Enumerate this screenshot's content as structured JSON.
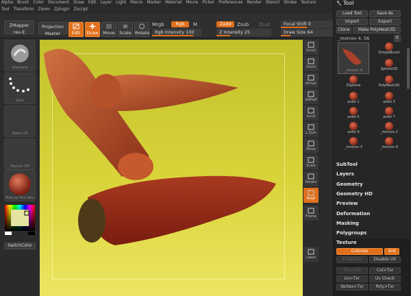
{
  "menu": {
    "row1": [
      "Alpha",
      "Brush",
      "Color",
      "Document",
      "Draw",
      "Edit",
      "Layer",
      "Light",
      "Macro",
      "Marker",
      "Material",
      "Movie",
      "Picker",
      "Preferences",
      "Render",
      "Stencil",
      "Stroke",
      "Texture"
    ],
    "row2": [
      "Tool",
      "Transform",
      "Zoom",
      "Zplugin",
      "Zscript"
    ]
  },
  "toolbar": {
    "zmapper": "ZMapper",
    "zmapper_sub": "rev-E",
    "projection": "Projection",
    "projection_sub": "Master",
    "edit": "Edit",
    "draw": "Draw",
    "move": "Move",
    "scale": "Scale",
    "rotate": "Rotate",
    "mrgb": "Mrgb",
    "rgb": "Rgb",
    "m": "M",
    "rgb_intensity": "Rgb Intensity 100",
    "zadd": "Zadd",
    "zsub": "Zsub",
    "zcut": "Zcut",
    "z_intensity": "Z Intensity 25",
    "focal_shift": "Focal Shift 0",
    "draw_size": "Draw Size 64"
  },
  "left_shelf": {
    "standard": "Standard",
    "dots": "Dots",
    "alpha_off": "Alpha Off",
    "texture_off": "Texture Off",
    "matcap": "MatCap Red Wax",
    "switch_color": "SwitchColor"
  },
  "right_shelf": [
    "Scroll",
    "Zoom",
    "Actual",
    "AAHalf",
    "Local",
    "L.Sym",
    "Move",
    "Scale",
    "Rotate",
    "PolyF",
    "Frame",
    "Lasso"
  ],
  "tool_panel": {
    "title": "Tool",
    "load_tool": "Load Tool",
    "save_as": "Save As",
    "import": "Import",
    "export": "Export",
    "clone": "Clone",
    "make_polymesh": "Make PolyMesh3D",
    "current_tool": "_morcov 4. 56",
    "r": "R",
    "current_thumb": "_morcov 4",
    "tools": [
      "SimpleBrush",
      "Sphere3D",
      "ZSphere",
      "PolyMesh3D",
      "ardei 1",
      "ardei 3",
      "ardei 5",
      "ardei 7",
      "ardei 9",
      "_morcov 2",
      "_morcov 3",
      "_morcov 4"
    ],
    "sections": [
      "SubTool",
      "Layers",
      "Geometry",
      "Geometry HD",
      "Preview",
      "Deformation",
      "Masking",
      "Polygroups"
    ],
    "texture_header": "Texture",
    "colorize": "Colorize",
    "grd": "Grd",
    "enable_uv": "EnableUV",
    "disable_uv": "Disable UV",
    "txr_col": "Txr>Col",
    "col_txr": "Col>Txr",
    "uv_txr": "Uv>Txr",
    "uv_check": "Uv Check",
    "vertex_txr": "Vertex>Txr",
    "poly_txr": "Poly>Txr"
  },
  "colors": {
    "accent": "#e0701c",
    "panel": "#262626",
    "viewport_top": "#c2c22c",
    "viewport_bottom": "#ece563",
    "carrot": "#b9502a"
  }
}
